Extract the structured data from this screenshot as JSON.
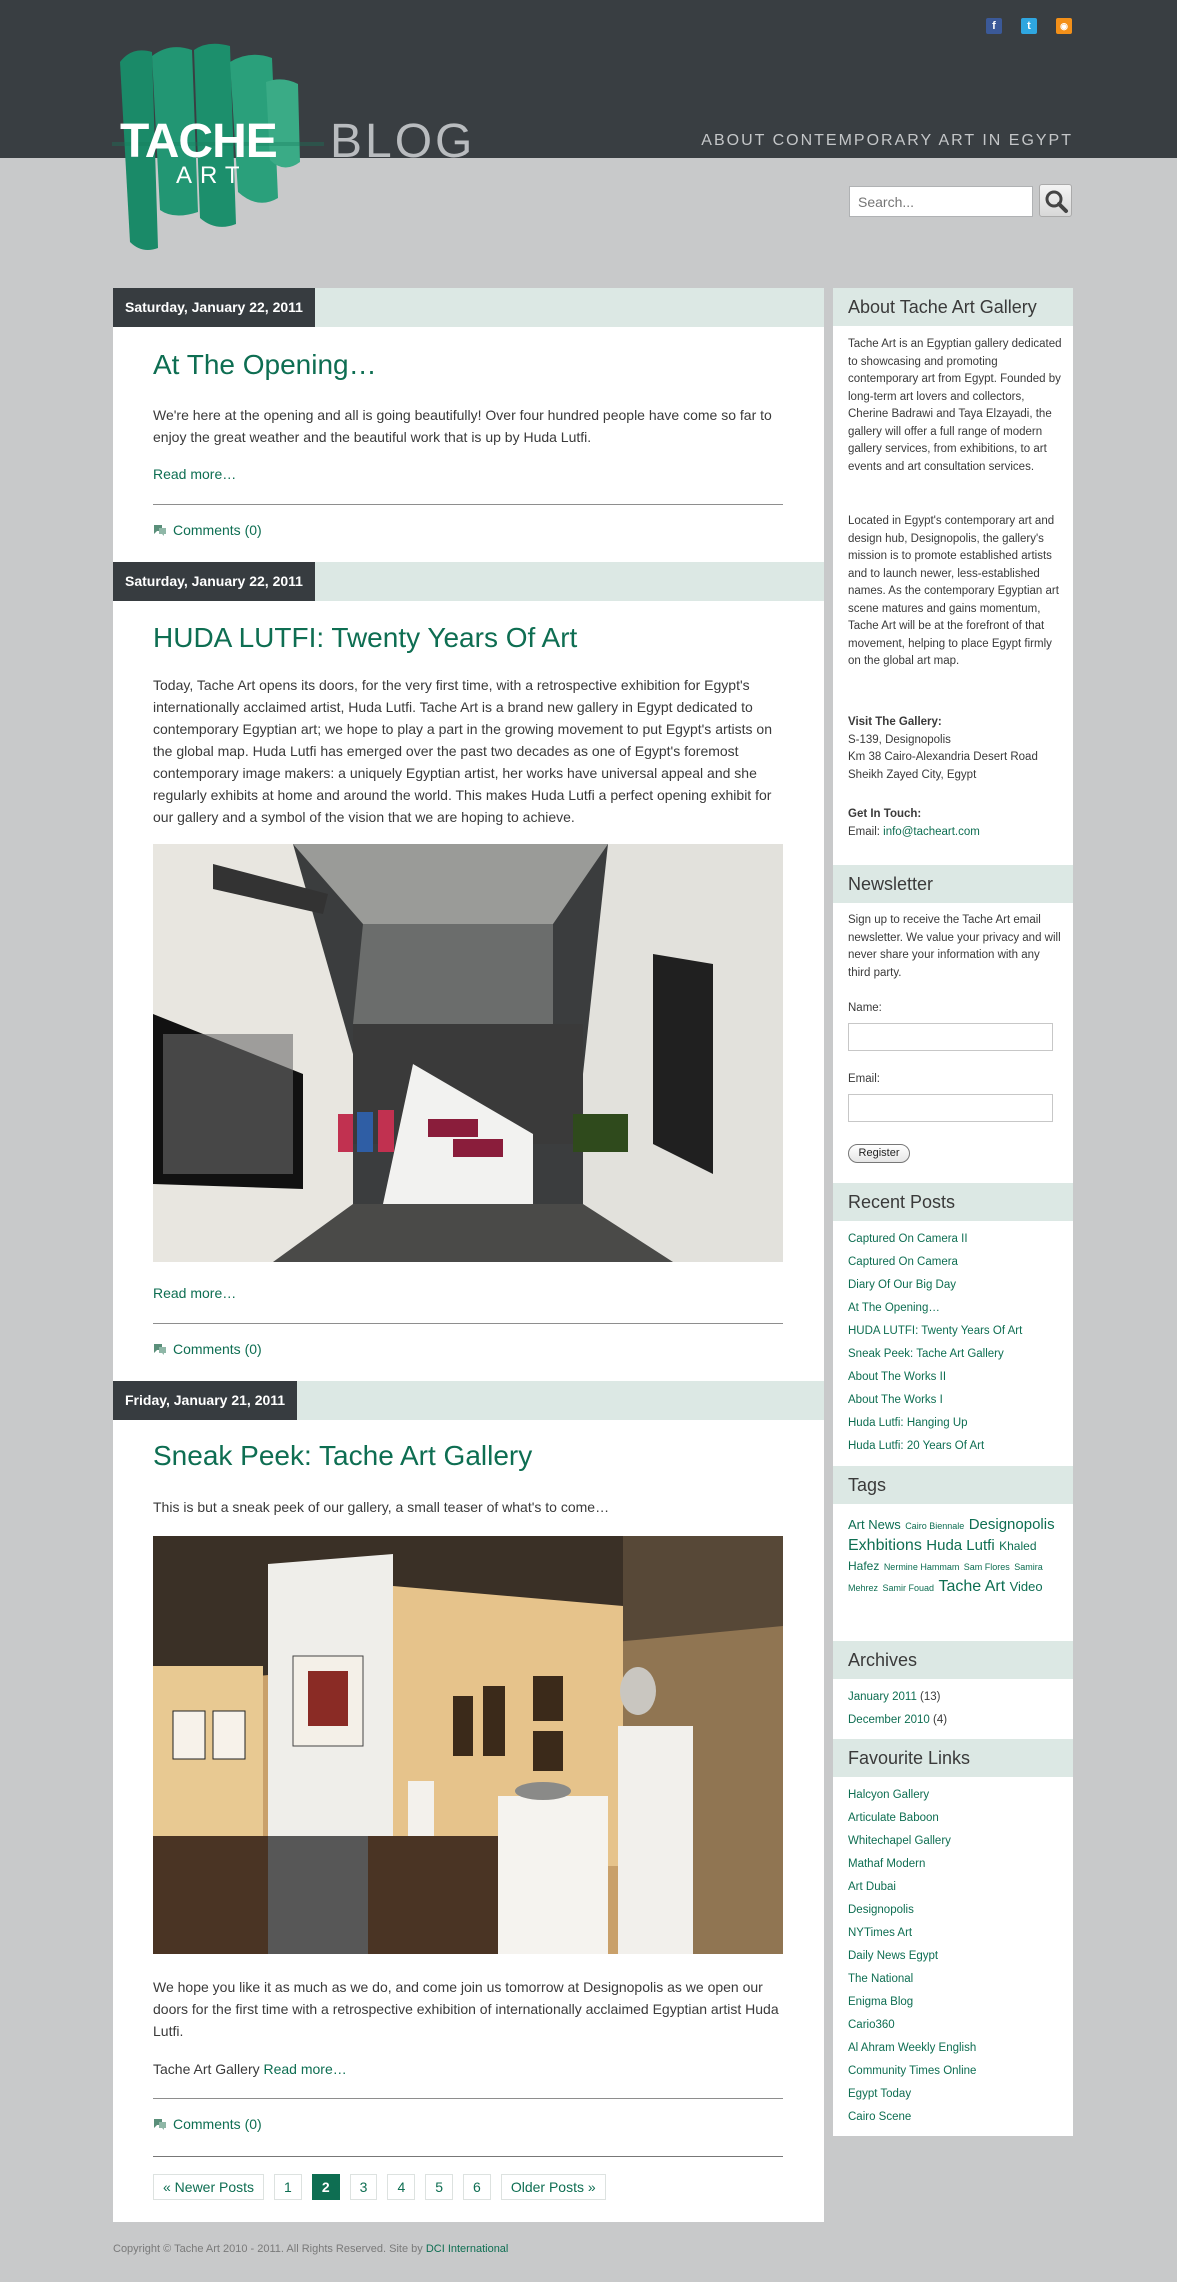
{
  "header": {
    "logo_tache": "TACHE",
    "logo_art": "ART",
    "logo_blog": "BLOG",
    "tagline": "ABOUT CONTEMPORARY ART IN EGYPT",
    "social_icons": [
      "facebook-icon",
      "twitter-icon",
      "rss-icon"
    ],
    "social_colors": [
      "#3b5998",
      "#2fa6e0",
      "#f39019"
    ],
    "search_placeholder": "Search..."
  },
  "posts": [
    {
      "date": "Saturday, January 22, 2011",
      "title": "At The Opening…",
      "body": "We're here at the opening and all is going beautifully! Over four hundred people have come so far to enjoy the great weather and the beautiful work that is up by Huda Lutfi.",
      "read_more": "Read more…",
      "comments": "Comments (0)"
    },
    {
      "date": "Saturday, January 22, 2011",
      "title": "HUDA LUTFI: Twenty Years Of Art",
      "body": "Today, Tache Art opens its doors, for the very first time, with a retrospective exhibition for Egypt's internationally acclaimed artist, Huda Lutfi. Tache Art is a brand new gallery in Egypt dedicated to contemporary Egyptian art; we hope to play a part in the growing movement to put Egypt's artists on the global map. Huda Lutfi has emerged over the past two decades as one of Egypt's foremost contemporary image makers: a uniquely Egyptian artist, her works have universal appeal and she regularly exhibits at home and around the world. This makes Huda Lutfi a perfect opening exhibit for our gallery and a symbol of the vision that we are hoping to achieve.",
      "read_more": "Read more…",
      "comments": "Comments (0)"
    },
    {
      "date": "Friday, January 21, 2011",
      "title": "Sneak Peek: Tache Art Gallery",
      "intro": "This is but a sneak peek of our gallery, a small teaser of what's to come…",
      "body": "We hope you like it as much as we do, and come join us tomorrow at Designopolis as we open our doors for the first time with a retrospective exhibition of internationally acclaimed Egyptian artist Huda Lutfi.",
      "signature": "Tache Art Gallery",
      "read_more": "Read more…",
      "comments": "Comments (0)"
    }
  ],
  "pagination": {
    "newer": "« Newer Posts",
    "pages": [
      "1",
      "2",
      "3",
      "4",
      "5",
      "6"
    ],
    "current": "2",
    "older": "Older Posts »"
  },
  "sidebar": {
    "about": {
      "heading": "About Tache Art Gallery",
      "p1": "Tache Art is an Egyptian gallery dedicated to showcasing and promoting contemporary art from Egypt. Founded by long-term art lovers and collectors, Cherine Badrawi and Taya Elzayadi, the gallery will offer a full range of modern gallery services, from exhibitions, to art events and art consultation services.",
      "p2": "Located in Egypt's contemporary art and design hub, Designopolis, the gallery's mission is to promote established artists and to launch newer, less-established names. As the contemporary Egyptian art scene matures and gains momentum, Tache Art will be at the forefront of that movement, helping to place Egypt firmly on the global art map.",
      "visit_label": "Visit The Gallery:",
      "address1": "S-139, Designopolis",
      "address2": "Km 38 Cairo-Alexandria Desert Road",
      "address3": "Sheikh Zayed City, Egypt",
      "contact_label": "Get In Touch:",
      "email_prefix": "Email:",
      "email": "info@tacheart.com"
    },
    "newsletter": {
      "heading": "Newsletter",
      "text": "Sign up to receive the Tache Art email newsletter. We value your privacy and will never share your information with any third party.",
      "name_label": "Name:",
      "email_label": "Email:",
      "register": "Register"
    },
    "recent": {
      "heading": "Recent Posts",
      "items": [
        "Captured On Camera II",
        "Captured On Camera",
        "Diary Of Our Big Day",
        "At The Opening…",
        "HUDA LUTFI: Twenty Years Of Art",
        "Sneak Peek: Tache Art Gallery",
        "About The Works II",
        "About The Works I",
        "Huda Lutfi: Hanging Up",
        "Huda Lutfi: 20 Years Of Art"
      ]
    },
    "tags": {
      "heading": "Tags",
      "items": [
        "Art News",
        "Cairo Biennale",
        "Designopolis",
        "Exhbitions",
        "Huda Lutfi",
        "Khaled Hafez",
        "Nermine Hammam",
        "Sam Flores",
        "Samira Mehrez",
        "Samir Fouad",
        "Tache Art",
        "Video"
      ]
    },
    "archives": {
      "heading": "Archives",
      "items": [
        {
          "label": "January 2011",
          "count": "(13)"
        },
        {
          "label": "December 2010",
          "count": "(4)"
        }
      ]
    },
    "links": {
      "heading": "Favourite Links",
      "items": [
        "Halcyon Gallery",
        "Articulate Baboon",
        "Whitechapel Gallery",
        "Mathaf Modern",
        "Art Dubai",
        "Designopolis",
        "NYTimes Art",
        "Daily News Egypt",
        "The National",
        "Enigma Blog",
        "Cario360",
        "Al Ahram Weekly English",
        "Community Times Online",
        "Egypt Today",
        "Cairo Scene"
      ]
    }
  },
  "footer": {
    "text": "Copyright © Tache Art 2010 - 2011. All Rights Reserved. Site by",
    "link": "DCI International"
  }
}
